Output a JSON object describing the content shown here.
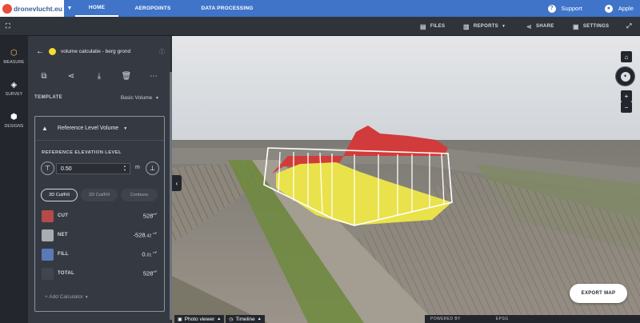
{
  "brand": {
    "name": "dronevlucht.eu"
  },
  "nav": {
    "tabs": [
      {
        "label": "HOME",
        "active": true
      },
      {
        "label": "AEROPOINTS",
        "active": false
      },
      {
        "label": "DATA PROCESSING",
        "active": false
      }
    ],
    "support_label": "Support",
    "user_label": "Apple"
  },
  "toolbar": {
    "files_label": "FILES",
    "reports_label": "REPORTS",
    "share_label": "SHARE",
    "settings_label": "SETTINGS"
  },
  "rail": {
    "items": [
      {
        "label": "MEASURE",
        "icon": "hexagon-icon",
        "active": true
      },
      {
        "label": "SURVEY",
        "icon": "layers-icon",
        "active": false
      },
      {
        "label": "DESIGNS",
        "icon": "cube-icon",
        "active": false
      }
    ]
  },
  "panel": {
    "title": "volume calculatie - berg grond",
    "template_label": "TEMPLATE",
    "template_value": "Basic Volume",
    "calculator": {
      "title": "Reference Level Volume",
      "ref_label": "REFERENCE ELEVATION LEVEL",
      "elevation_value": "0.50",
      "unit": "m",
      "modes": [
        "3D Cut/Fill",
        "2D Cut/Fill",
        "Contours"
      ],
      "active_mode": "3D Cut/Fill",
      "results": [
        {
          "name": "CUT",
          "value": "528",
          "unit": "m³",
          "color": "#b54a4a"
        },
        {
          "name": "NET",
          "value": "-528.",
          "value_small": "42",
          "unit": "m³",
          "color": "#a9acb0"
        },
        {
          "name": "FILL",
          "value": "0.",
          "value_small": "01",
          "unit": "m³",
          "color": "#5b78b8"
        },
        {
          "name": "TOTAL",
          "value": "528",
          "unit": "m³",
          "color": "#404650"
        }
      ],
      "add_label": "+ Add Calculator"
    }
  },
  "viewer": {
    "export_label": "EXPORT MAP",
    "photo_viewer_label": "Photo viewer",
    "timeline_label": "Timeline",
    "powered_label": "POWERED BY",
    "epsg_label": "EPSG"
  },
  "colors": {
    "accent": "#3f74c9",
    "panel": "#353a42",
    "cut": "#d23b3b",
    "fill_stockpile": "#e9e24a"
  }
}
